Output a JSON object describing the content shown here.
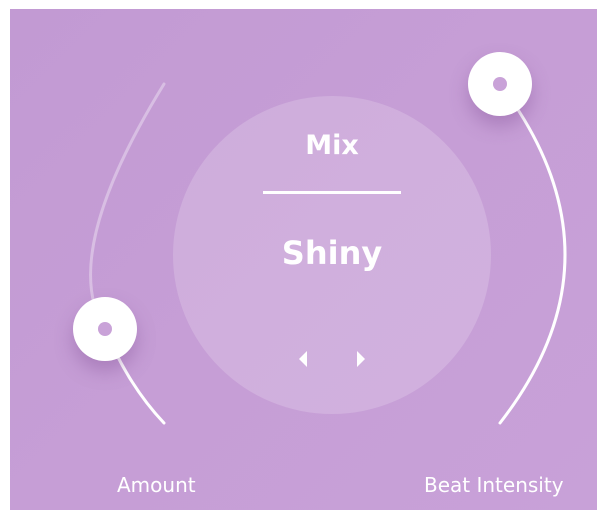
{
  "mixer": {
    "title": "Mix",
    "preset": "Shiny",
    "prev_icon": "chevron-left-icon",
    "next_icon": "chevron-right-icon"
  },
  "controls": {
    "amount": {
      "label": "Amount",
      "icon": "knob-handle-icon"
    },
    "beat_intensity": {
      "label": "Beat Intensity",
      "icon": "knob-handle-icon"
    }
  },
  "colors": {
    "background": "#c69ed6",
    "accent": "#ffffff",
    "knob_dot": "#c9a2d8"
  }
}
